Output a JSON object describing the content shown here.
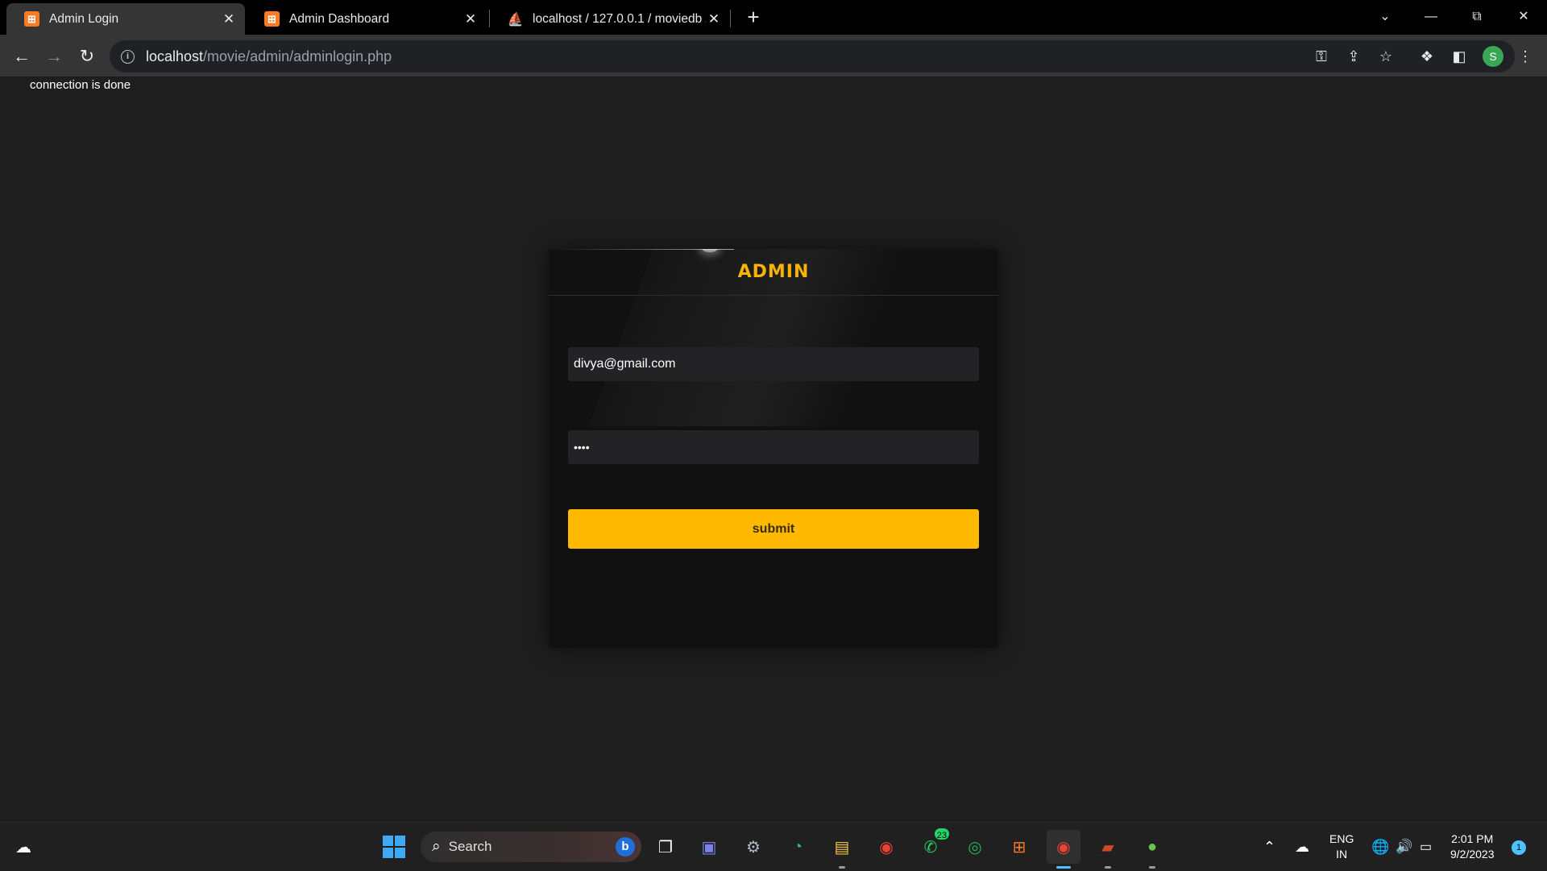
{
  "browser": {
    "tabs": [
      {
        "title": "Admin Login",
        "favicon": "xampp-icon"
      },
      {
        "title": "Admin Dashboard",
        "favicon": "xampp-icon"
      },
      {
        "title": "localhost / 127.0.0.1 / moviedb /",
        "favicon": "phpmyadmin-icon"
      }
    ],
    "url": {
      "host": "localhost",
      "path": "/movie/admin/adminlogin.php"
    },
    "profile_initial": "S"
  },
  "page": {
    "connection_message": "connection is done",
    "card": {
      "title": "ADMIN",
      "email_value": "divya@gmail.com",
      "password_mask": "••••",
      "submit_label": "submit"
    }
  },
  "taskbar": {
    "search_label": "Search",
    "whatsapp_badge": "23",
    "language_line1": "ENG",
    "language_line2": "IN",
    "time": "2:01 PM",
    "date": "9/2/2023",
    "notification_count": "1"
  },
  "colors": {
    "accent": "#ffba00",
    "card_bg": "#111111",
    "page_bg": "#1e1e1e"
  }
}
